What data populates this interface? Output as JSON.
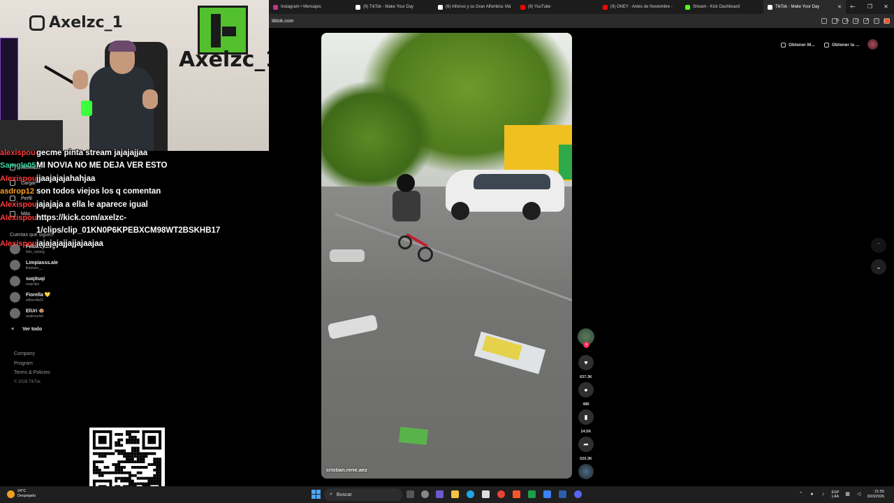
{
  "browser": {
    "tabs": [
      {
        "label": "Instagram • Mensajes",
        "color": "#c13584",
        "active": false
      },
      {
        "label": "(9) TikTok - Make Your Day",
        "color": "#ffffff",
        "active": false
      },
      {
        "label": "(6) Alfonso y su Gran Alfombra: Má",
        "color": "#ffffff",
        "active": false
      },
      {
        "label": "(9) YouTube",
        "color": "#ff0000",
        "active": false
      },
      {
        "label": "(9) ONEY - Antes de Noviembre -",
        "color": "#ff0000",
        "active": false
      },
      {
        "label": "Stream - Kick Dashboard",
        "color": "#53fc18",
        "active": false
      },
      {
        "label": "TikTok - Make Your Day",
        "color": "#ffffff",
        "active": true
      }
    ],
    "new_tab": "+",
    "minimize": "–",
    "restore": "❐",
    "close": "✕",
    "url": "tiktok.com"
  },
  "webcam": {
    "channel_name": "Axelzc_1",
    "ig_handle": "Axelzc_1"
  },
  "sidebar": {
    "nav": [
      {
        "label": "Actividad",
        "icon": "activity-icon"
      },
      {
        "label": "Cargar",
        "icon": "upload-icon"
      },
      {
        "label": "Perfil",
        "icon": "profile-icon"
      },
      {
        "label": "Más",
        "icon": "more-icon"
      }
    ],
    "following_title": "Cuentas que sigues",
    "accounts": [
      {
        "name": "Felix Nyberg",
        "handle": "felix_nyberg"
      },
      {
        "name": "Limpiasss.ale",
        "handle": "limpiass__"
      },
      {
        "name": "suqituqi",
        "handle": "suqiclips"
      },
      {
        "name": "Fiorella 💛",
        "handle": "skfiorella01"
      },
      {
        "name": "ElUri 🐵",
        "handle": "avalosuriiel"
      }
    ],
    "see_all": "Ver todo",
    "footer": [
      "Company",
      "Program",
      "Terms & Policies"
    ],
    "copyright": "© 2026 TikTok"
  },
  "chat": [
    {
      "user": "alexispou",
      "color": "#ff3b3b",
      "message": "gecme pinta stream jajajajjaa"
    },
    {
      "user": "Samgle05",
      "color": "#3bd6a5",
      "message": "MI NOVIA NO ME DEJA VER ESTO"
    },
    {
      "user": "Alexispou",
      "color": "#ff3b3b",
      "message": "jjaajajajahahjaa"
    },
    {
      "user": "asdrop12",
      "color": "#ffa21f",
      "message": "son todos viejos los q comentan"
    },
    {
      "user": "Alexispou",
      "color": "#ff3b3b",
      "message": "jajajaja a ella le aparece igual"
    },
    {
      "user": "Alexispou",
      "color": "#ff3b3b",
      "message": "https://kick.com/axelzc-"
    },
    {
      "user": "",
      "color": "#ff3b3b",
      "message": "1/clips/clip_01KN0P6KPEBXCM98WT2BSKHB17"
    },
    {
      "user": "Alexispou",
      "color": "#ff3b3b",
      "message": "jajajajajjajjajaajaa"
    }
  ],
  "video": {
    "author": "cristian.rene.aez"
  },
  "actions": {
    "likes": "637.3K",
    "comments": "486",
    "saves": "24.5K",
    "shares": "520.3K"
  },
  "header": {
    "get_app": "Obtener M...",
    "get_pc": "Obtener la ..."
  },
  "taskbar": {
    "temperature": "24°C",
    "weather": "Despejado",
    "search": "Buscar",
    "lang1": "ESP",
    "lang2": "LAA",
    "time": "21:55",
    "date": "30/3/2026"
  }
}
